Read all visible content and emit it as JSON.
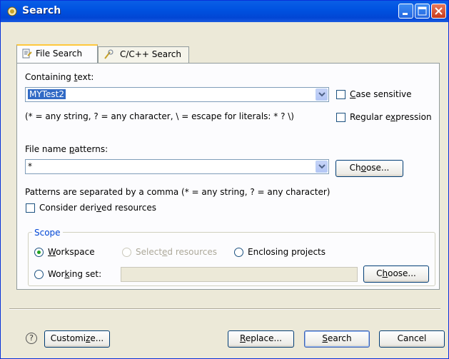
{
  "window": {
    "title": "Search",
    "icon": "search-flashlight-icon"
  },
  "tabs": [
    {
      "label_pre": "File Search",
      "icon": "file-search-icon",
      "active": true
    },
    {
      "label_pre": "C/C++ Search",
      "icon": "cpp-search-icon",
      "active": false
    }
  ],
  "containing": {
    "label_pre": "Containing ",
    "label_ul": "t",
    "label_post": "ext:",
    "value": "MYTest2",
    "hint": "(* = any string, ? = any character, \\ = escape for literals: * ? \\)",
    "case_sensitive": {
      "label_ul": "C",
      "label_post": "ase sensitive",
      "checked": false
    },
    "regex": {
      "label_pre": "Regular e",
      "label_ul": "x",
      "label_post": "pression",
      "checked": false
    }
  },
  "file_name": {
    "label_pre": "File name ",
    "label_ul": "p",
    "label_post": "atterns:",
    "value": "*",
    "choose_pre": "Ch",
    "choose_ul": "o",
    "choose_post": "ose...",
    "hint": "Patterns are separated by a comma (* = any string, ? = any character)",
    "derived": {
      "label_pre": "Consider deri",
      "label_ul": "v",
      "label_post": "ed resources",
      "checked": false
    }
  },
  "scope": {
    "title": "Scope",
    "workspace": {
      "label_ul": "W",
      "label_post": "orkspace",
      "selected": true
    },
    "selected_resources": {
      "label_pre": "Select",
      "label_ul": "e",
      "label_post": "d resources",
      "enabled": false
    },
    "enclosing": {
      "label_pre": "Enclosing pro",
      "label_ul": "j",
      "label_post": "ects"
    },
    "working_set": {
      "label_pre": "Wor",
      "label_ul": "k",
      "label_post": "ing set:",
      "value": ""
    },
    "choose_pre": "C",
    "choose_ul": "h",
    "choose_post": "oose..."
  },
  "footer": {
    "help": "?",
    "customize_pre": "Customi",
    "customize_ul": "z",
    "customize_post": "e...",
    "replace_ul": "R",
    "replace_post": "eplace...",
    "search_ul": "S",
    "search_post": "earch",
    "cancel": "Cancel"
  }
}
